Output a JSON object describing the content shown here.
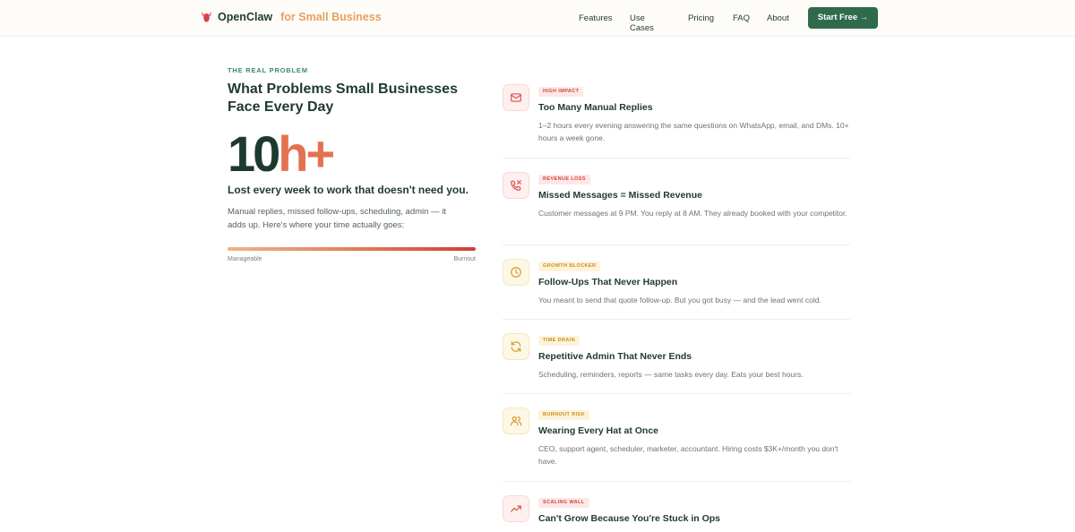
{
  "nav": {
    "brand_name": "OpenClaw",
    "brand_sub": "for Small Business",
    "links": [
      "Features",
      "Use Cases",
      "Pricing",
      "FAQ",
      "About"
    ],
    "cta": "Start Free →"
  },
  "hero": {
    "eyebrow": "THE REAL PROBLEM",
    "heading": "What Problems Small Businesses Face Every Day",
    "stat_number": "10",
    "stat_unit": "h+",
    "stat_caption": "Lost every week to work that doesn't need you.",
    "body": "Manual replies, missed follow-ups, scheduling, admin — it adds up. Here's where your time actually goes:",
    "scale_low": "Manageable",
    "scale_high": "Burnout"
  },
  "problems": [
    {
      "badge": "HIGH IMPACT",
      "title": "Too Many Manual Replies",
      "desc": "1–2 hours every evening answering the same questions on WhatsApp, email, and DMs. 10+ hours a week gone.",
      "icon": "mail-icon",
      "tone": "red"
    },
    {
      "badge": "REVENUE LOSS",
      "title": "Missed Messages = Missed Revenue",
      "desc": "Customer messages at 9 PM. You reply at 8 AM. They already booked with your competitor.",
      "icon": "phone-missed-icon",
      "tone": "red"
    },
    {
      "badge": "GROWTH BLOCKER",
      "title": "Follow-Ups That Never Happen",
      "desc": "You meant to send that quote follow-up. But you got busy — and the lead went cold.",
      "icon": "clock-icon",
      "tone": "amber"
    },
    {
      "badge": "TIME DRAIN",
      "title": "Repetitive Admin That Never Ends",
      "desc": "Scheduling, reminders, reports — same tasks every day. Eats your best hours.",
      "icon": "refresh-icon",
      "tone": "amber"
    },
    {
      "badge": "BURNOUT RISK",
      "title": "Wearing Every Hat at Once",
      "desc": "CEO, support agent, scheduler, marketer, accountant. Hiring costs $3K+/month you don't have.",
      "icon": "users-icon",
      "tone": "amber"
    },
    {
      "badge": "SCALING WALL",
      "title": "Can't Grow Because You're Stuck in Ops",
      "desc": "",
      "icon": "trending-up-icon",
      "tone": "red"
    }
  ]
}
